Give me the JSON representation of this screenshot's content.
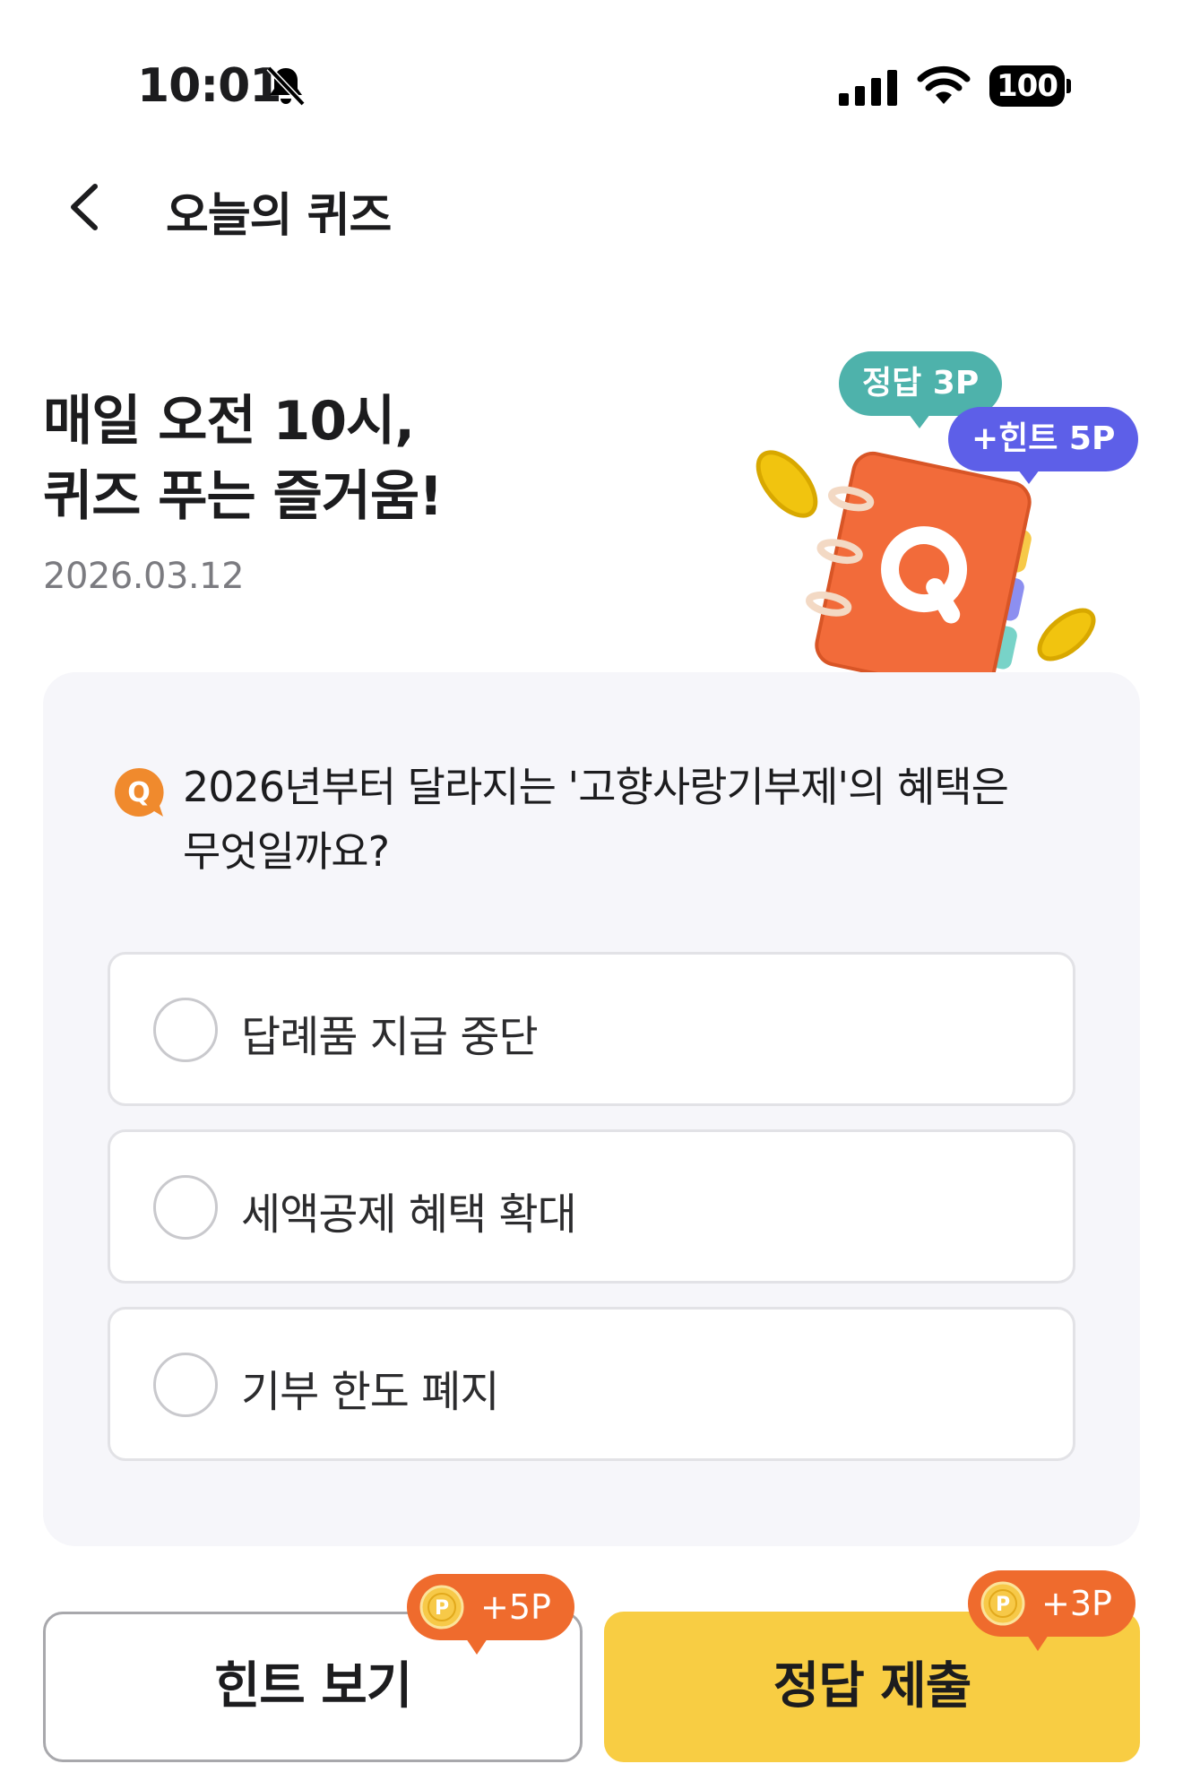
{
  "status_bar": {
    "time": "10:01",
    "battery": "100"
  },
  "header": {
    "title": "오늘의 퀴즈"
  },
  "hero": {
    "title_line1": "매일 오전 10시,",
    "title_line2": "퀴즈 푸는 즐거움!",
    "date": "2026.03.12",
    "bubble_answer": "정답 3P",
    "bubble_hint": "+힌트 5P",
    "illustration_letter": "Q"
  },
  "quiz": {
    "badge": "Q",
    "question": "2026년부터 달라지는 '고향사랑기부제'의 혜택은 무엇일까요?",
    "options": [
      {
        "label": "답례품 지급 중단"
      },
      {
        "label": "세액공제 혜택 확대"
      },
      {
        "label": "기부 한도 폐지"
      }
    ]
  },
  "actions": {
    "hint_label": "힌트 보기",
    "hint_points": "+5P",
    "submit_label": "정답 제출",
    "submit_points": "+3P",
    "coin_letter": "P"
  },
  "colors": {
    "primary_yellow": "#f8cd43",
    "point_orange": "#ef6b2d",
    "answer_teal": "#4eb2ab",
    "hint_purple": "#5d5fe8",
    "card_bg": "#f6f6fa"
  }
}
